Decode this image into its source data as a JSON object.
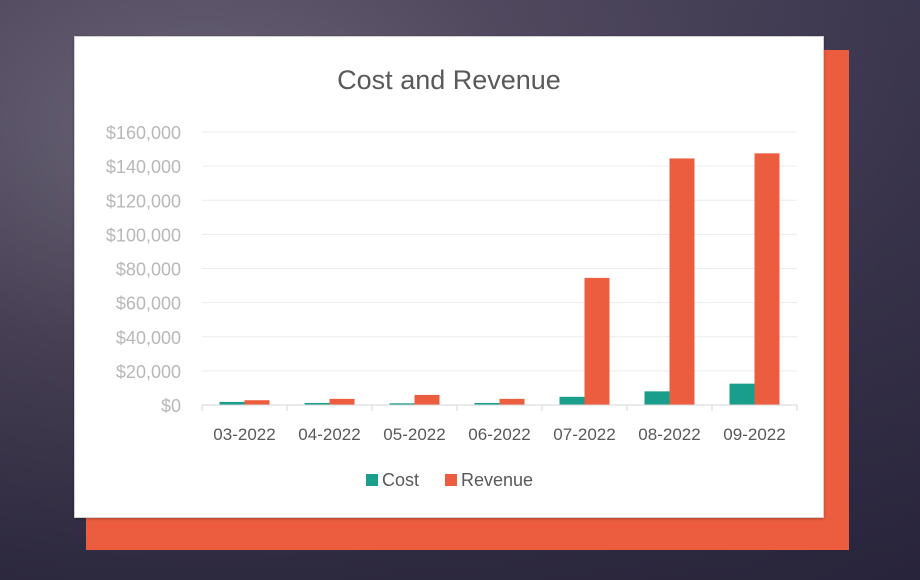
{
  "chart_data": {
    "type": "bar",
    "title": "Cost and Revenue",
    "xlabel": "",
    "ylabel": "",
    "categories": [
      "03-2022",
      "04-2022",
      "05-2022",
      "06-2022",
      "07-2022",
      "08-2022",
      "09-2022"
    ],
    "series": [
      {
        "name": "Cost",
        "color": "#1a9e8c",
        "values": [
          1800,
          1200,
          1000,
          1200,
          4800,
          8000,
          12500
        ]
      },
      {
        "name": "Revenue",
        "color": "#ec5d3f",
        "values": [
          2800,
          3600,
          5900,
          3600,
          74500,
          144500,
          147500
        ]
      }
    ],
    "ylim": [
      0,
      160000
    ],
    "yticks": [
      "$0",
      "$20,000",
      "$40,000",
      "$60,000",
      "$80,000",
      "$100,000",
      "$120,000",
      "$140,000",
      "$160,000"
    ],
    "grid": true,
    "legend": "bottom"
  }
}
